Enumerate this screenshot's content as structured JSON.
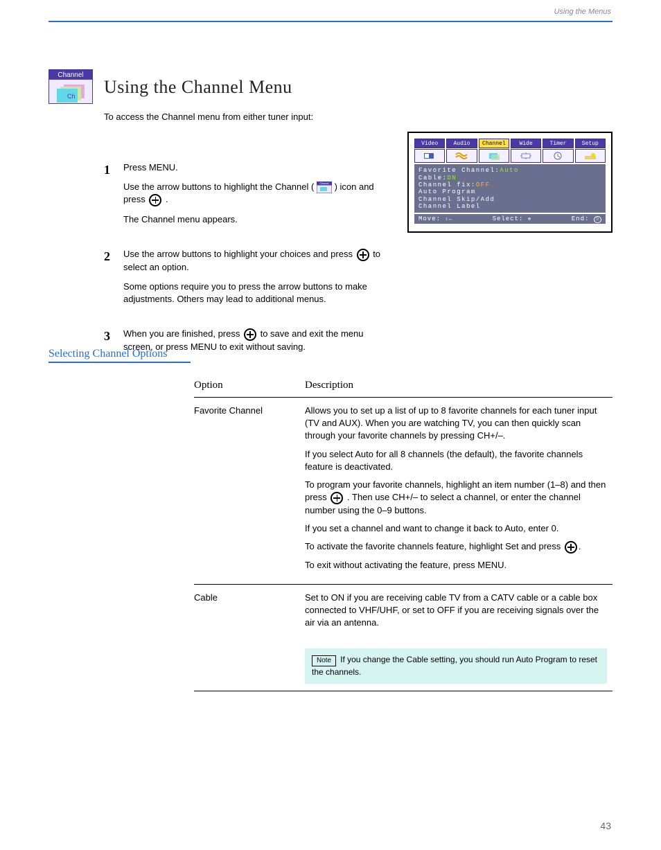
{
  "chapter": "Using the Menus",
  "page_number": "43",
  "heading": "Using the Channel Menu",
  "intro": "To access the Channel menu from either tuner input:",
  "steps": [
    {
      "n": "1",
      "lines": [
        "Press MENU.",
        "Use the arrow buttons to highlight the Channel ( ___ICON___  ) icon and press ___SEL___ .",
        "The Channel menu appears."
      ]
    },
    {
      "n": "2",
      "lines": [
        "Use the arrow buttons to highlight your choices and press ___SEL___ to select an option.",
        "Some options require you to press the arrow buttons to make adjustments. Others may lead to additional menus."
      ]
    },
    {
      "n": "3",
      "lines": [
        "When you are finished, press ___SEL___ to save and exit the menu screen, or press MENU to exit without saving."
      ]
    }
  ],
  "section_title": "Selecting Channel Options",
  "table": {
    "head": [
      "Option",
      "Description"
    ],
    "rows": [
      {
        "opt": "Favorite Channel",
        "desc_lines": [
          "Allows you to set up a list of up to 8 favorite channels for each tuner input (TV and AUX). When you are watching TV, you can then quickly scan through your favorite channels by pressing CH+/–.",
          "If you select Auto for all 8 channels (the default), the favorite channels feature is deactivated.",
          "To program your favorite channels, highlight an item number (1–8) and then press ___SEL___ . Then use CH+/– to select a channel, or enter the channel number using the 0–9 buttons.",
          "If you set a channel and want to change it back to Auto, enter 0.",
          "To activate the favorite channels feature, highlight Set and press ___SEL___.",
          "To exit without activating the feature, press MENU."
        ]
      },
      {
        "opt": "Cable",
        "desc_lines": [
          "Set to ON if you are receiving cable TV from a CATV cable or a cable box connected to VHF/UHF, or set to OFF if you are receiving signals over the air via an antenna."
        ],
        "note": "If you change the Cable setting, you should run Auto Program to reset the channels."
      }
    ]
  },
  "osd": {
    "tabs": [
      "Video",
      "Audio",
      "Channel",
      "Wide",
      "Timer",
      "Setup"
    ],
    "active_tab": 2,
    "lines": [
      {
        "label": "Favorite Channel:",
        "val": "Auto",
        "cls": "auto"
      },
      {
        "label": "Cable:",
        "val": "ON",
        "cls": "on"
      },
      {
        "label": "Channel fix:",
        "val": "OFF",
        "cls": "off"
      },
      {
        "label": "Auto Program",
        "val": "",
        "cls": ""
      },
      {
        "label": "Channel Skip/Add",
        "val": "",
        "cls": ""
      },
      {
        "label": "Channel Label",
        "val": "",
        "cls": ""
      }
    ],
    "foot": {
      "move": "Move:",
      "select": "Select:",
      "end": "End:"
    }
  }
}
